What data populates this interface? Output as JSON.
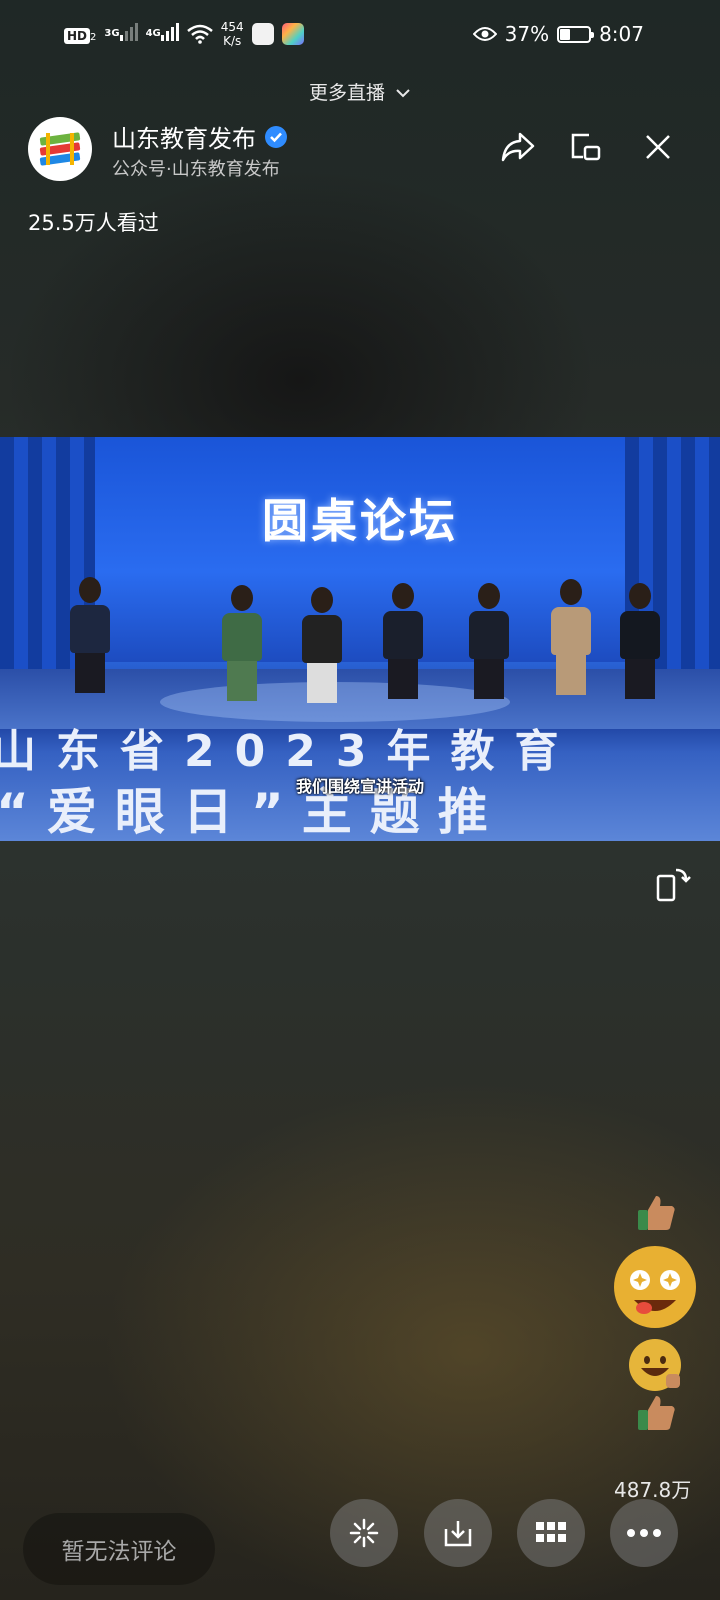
{
  "status_bar": {
    "hd": "HD",
    "sim": "2",
    "net1": "3G",
    "net2": "4G",
    "speed_value": "454",
    "speed_unit": "K/s",
    "battery_percent": "37%",
    "battery_level": 0.37,
    "time": "8:07"
  },
  "top": {
    "more_live": "更多直播"
  },
  "channel": {
    "name": "山东教育发布",
    "subtitle": "公众号·山东教育发布",
    "viewers": "25.5万人看过"
  },
  "video": {
    "stage_title": "圆桌论坛",
    "banner_line1": "山东省2023年教育",
    "banner_line2": "“爱眼日”主题推",
    "caption": "我们围绕宣讲活动"
  },
  "reactions": {
    "like_count": "487.8万"
  },
  "bottom": {
    "comment_placeholder": "暂无法评论"
  },
  "icons": {
    "header": [
      "share-icon",
      "pip-icon",
      "close-icon"
    ],
    "bottom": [
      "sparkle-icon",
      "download-icon",
      "grid-icon",
      "more-icon"
    ]
  },
  "colors": {
    "verified": "#2f8cff",
    "video_bg": "#1c4fc4"
  }
}
